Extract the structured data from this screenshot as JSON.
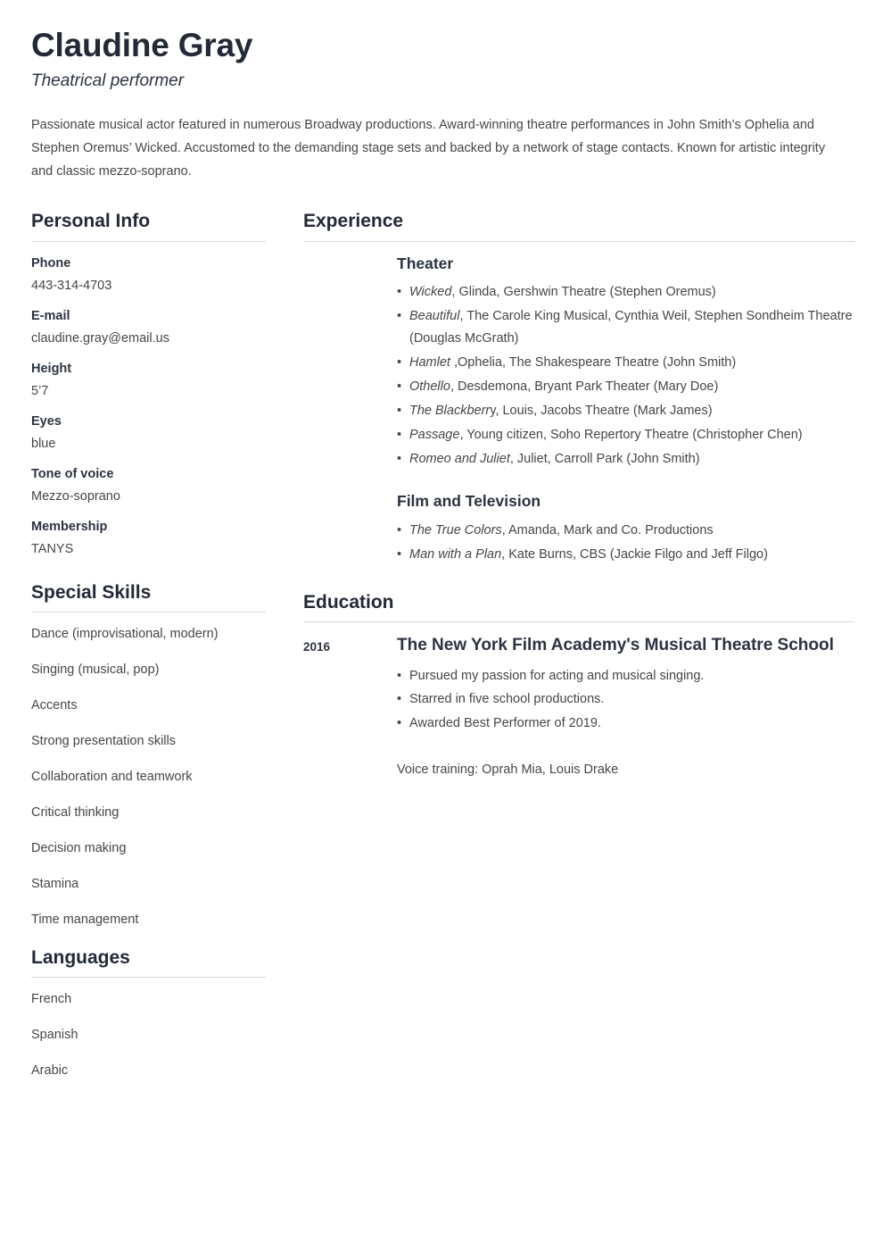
{
  "header": {
    "name": "Claudine Gray",
    "job_title": "Theatrical performer",
    "summary": "Passionate musical actor featured in numerous Broadway productions. Award-winning theatre performances in John Smith’s Ophelia and Stephen Oremus’ Wicked. Accustomed to the demanding stage sets and backed by a network of stage contacts. Known for artistic integrity and classic mezzo-soprano."
  },
  "personal_info": {
    "title": "Personal Info",
    "items": [
      {
        "label": "Phone",
        "value": "443-314-4703"
      },
      {
        "label": "E-mail",
        "value": "claudine.gray@email.us"
      },
      {
        "label": "Height",
        "value": "5’7"
      },
      {
        "label": "Eyes",
        "value": "blue"
      },
      {
        "label": "Tone of voice",
        "value": "Mezzo-soprano"
      },
      {
        "label": "Membership",
        "value": "TANYS"
      }
    ]
  },
  "special_skills": {
    "title": "Special Skills",
    "items": [
      "Dance (improvisational, modern)",
      "Singing (musical, pop)",
      "Accents",
      "Strong presentation skills",
      "Collaboration and teamwork",
      "Critical thinking",
      "Decision making",
      "Stamina",
      "Time management"
    ]
  },
  "languages": {
    "title": "Languages",
    "items": [
      "French",
      "Spanish",
      "Arabic"
    ]
  },
  "experience": {
    "title": "Experience",
    "groups": [
      {
        "subtitle": "Theater",
        "items": [
          {
            "title": "Wicked",
            "rest": ", Glinda, Gershwin Theatre (Stephen Oremus)"
          },
          {
            "title": "Beautiful",
            "rest": ", The Carole King Musical, Cynthia Weil, Stephen Sondheim Theatre (Douglas McGrath)"
          },
          {
            "title": "Hamlet",
            "rest": " ,Ophelia, The Shakespeare Theatre (John Smith)"
          },
          {
            "title": "Othello",
            "rest": ", Desdemona, Bryant Park Theater (Mary Doe)"
          },
          {
            "title": "The Blackberr",
            "rest": "y, Louis, Jacobs Theatre (Mark James)"
          },
          {
            "title": "Passage",
            "rest": ", Young citizen, Soho Repertory Theatre (Christopher Chen)"
          },
          {
            "title": "Romeo and Juliet",
            "rest": ", Juliet, Carroll Park (John Smith)"
          }
        ]
      },
      {
        "subtitle": "Film and Television",
        "items": [
          {
            "title": "The True Colors",
            "rest": ", Amanda, Mark and Co. Productions"
          },
          {
            "title": "Man with a Plan",
            "rest": ", Kate Burns, CBS (Jackie Filgo and Jeff Filgo)"
          }
        ]
      }
    ]
  },
  "education": {
    "title": "Education",
    "year": "2016",
    "school": "The New York Film Academy's Musical Theatre School",
    "bullets": [
      "Pursued my passion for acting and musical singing.",
      "Starred in five school productions.",
      "Awarded Best Performer of 2019."
    ],
    "note": "Voice training: Oprah Mia, Louis Drake"
  },
  "colors": {
    "heading": "#232936",
    "body_text": "#46464a",
    "rule": "#d9d9d9",
    "background": "#ffffff"
  }
}
